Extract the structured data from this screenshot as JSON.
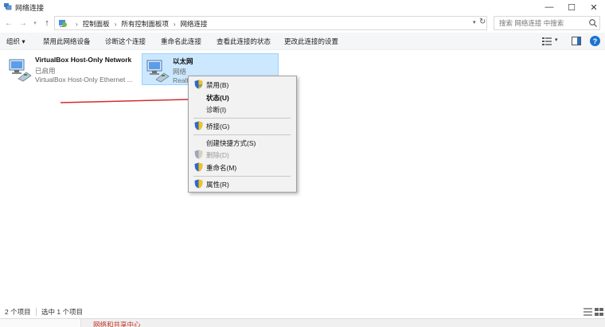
{
  "window": {
    "title": "网络连接",
    "controls": {
      "minimize": "—",
      "maximize": "☐",
      "close": "✕"
    }
  },
  "address": {
    "breadcrumbs": [
      "控制面板",
      "所有控制面板项",
      "网络连接"
    ],
    "search_placeholder": "搜索\"网络连接\"",
    "search_visible_text": "搜索 网络连接 中搜索"
  },
  "toolbar": {
    "commands": [
      "组织 ▾",
      "禁用此网络设备",
      "诊断这个连接",
      "重命名此连接",
      "查看此连接的状态",
      "更改此连接的设置"
    ]
  },
  "items": [
    {
      "name": "VirtualBox Host-Only Network",
      "status": "已启用",
      "description": "VirtualBox Host-Only Ethernet ..."
    },
    {
      "name": "以太网",
      "status": "网络",
      "description": "Realtek PCIe GbE Family Controller",
      "selected": true
    }
  ],
  "context_menu": {
    "items": [
      {
        "label": "禁用(B)",
        "shield": true
      },
      {
        "label": "状态(U)",
        "bold": true
      },
      {
        "label": "诊断(I)"
      },
      {
        "label": "桥接(G)",
        "shield": true
      },
      {
        "label": "创建快捷方式(S)"
      },
      {
        "label": "删除(D)",
        "shield": true,
        "disabled": true
      },
      {
        "label": "重命名(M)",
        "shield": true
      },
      {
        "label": "属性(R)",
        "shield": true
      }
    ]
  },
  "statusbar": {
    "count": "2 个项目",
    "selected": "选中 1 个项目"
  },
  "footer": {
    "link": "网络和共享中心"
  },
  "colors": {
    "selection_bg": "#cce8ff",
    "selection_border": "#99d1ff",
    "annotation_arrow": "#d62b2b",
    "help_accent": "#1c73d1"
  }
}
